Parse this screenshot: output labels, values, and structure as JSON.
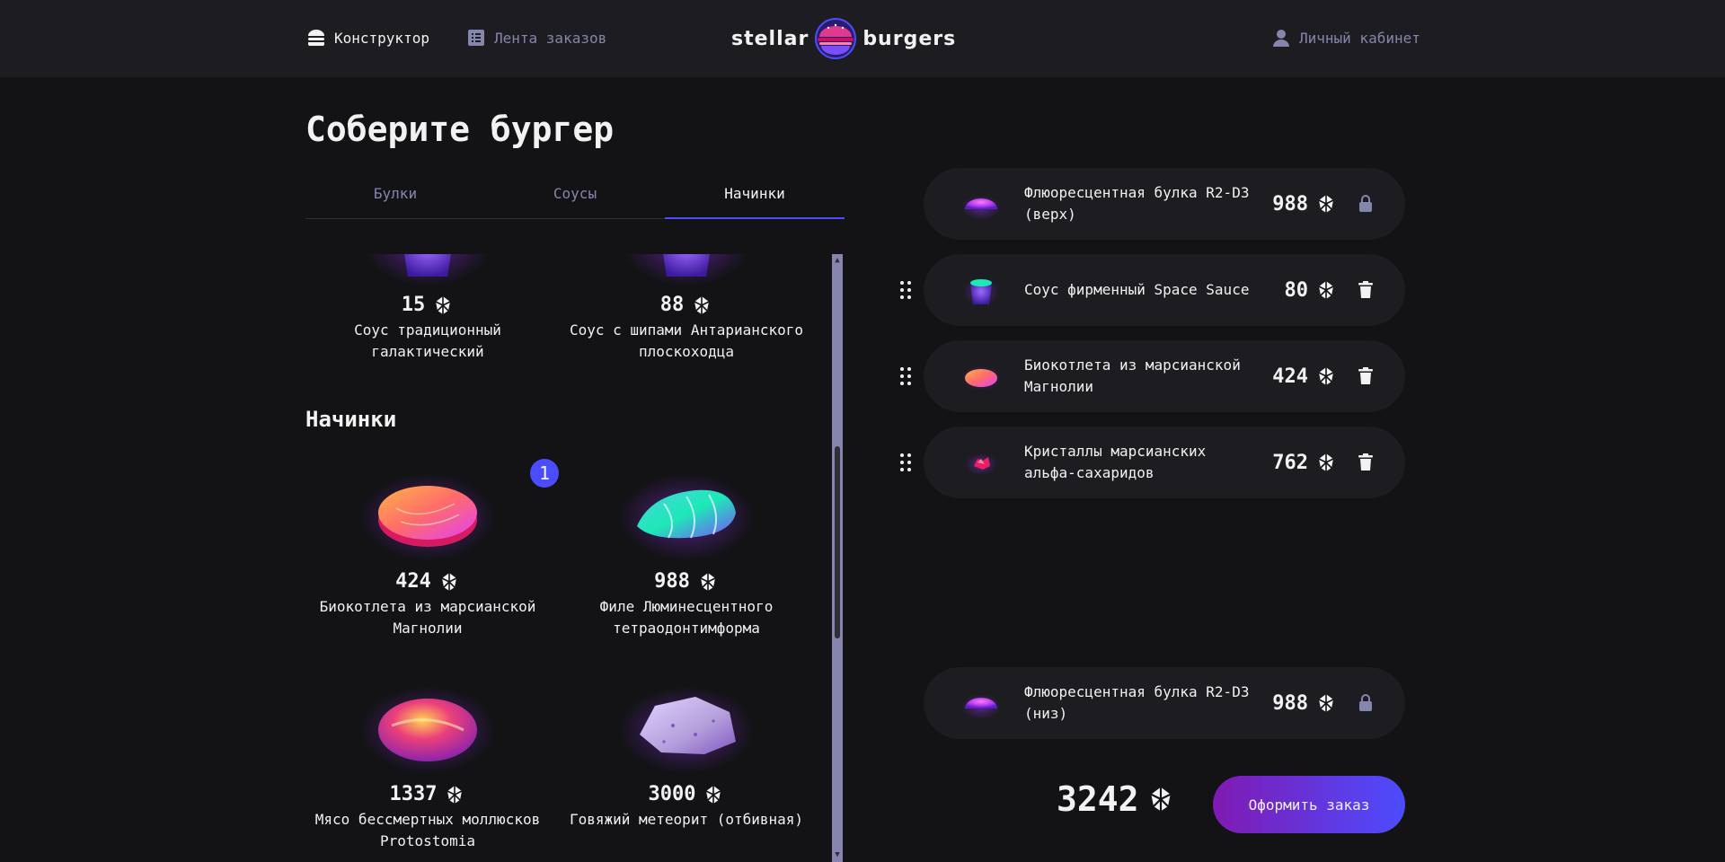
{
  "header": {
    "nav": {
      "constructor": "Конструктор",
      "feed": "Лента заказов",
      "profile": "Личный кабинет"
    },
    "logo": {
      "left": "stellar",
      "right": "burgers"
    }
  },
  "page_title": "Соберите бургер",
  "tabs": [
    "Булки",
    "Соусы",
    "Начинки"
  ],
  "active_tab": "Начинки",
  "ingredients": {
    "sauces_visible": [
      {
        "price": "15",
        "name": "Соус традиционный галактический"
      },
      {
        "price": "88",
        "name": "Соус с шипами Антарианского плоскоходца"
      }
    ],
    "fillings_title": "Начинки",
    "fillings": [
      {
        "price": "424",
        "name": "Биокотлета из марсианской Магнолии",
        "count": "1"
      },
      {
        "price": "988",
        "name": "Филе Люминесцентного тетраодонтимформа"
      },
      {
        "price": "1337",
        "name": "Мясо бессмертных моллюсков Protostomia"
      },
      {
        "price": "3000",
        "name": "Говяжий метеорит (отбивная)"
      }
    ]
  },
  "constructor": {
    "bun_top": {
      "name": "Флюоресцентная булка R2-D3 (верх)",
      "price": "988"
    },
    "items": [
      {
        "name": "Соус фирменный Space Sauce",
        "price": "80"
      },
      {
        "name": "Биокотлета из марсианской Магнолии",
        "price": "424"
      },
      {
        "name": "Кристаллы марсианских альфа-сахаридов",
        "price": "762"
      }
    ],
    "bun_bottom": {
      "name": "Флюоресцентная булка R2-D3 (низ)",
      "price": "988"
    }
  },
  "total": "3242",
  "order_button": "Оформить заказ",
  "colors": {
    "background": "#131316",
    "panel": "#1c1c21",
    "accent": "#4c4cff",
    "inactive": "#8585ad",
    "button_gradient_start": "#801ab2"
  }
}
